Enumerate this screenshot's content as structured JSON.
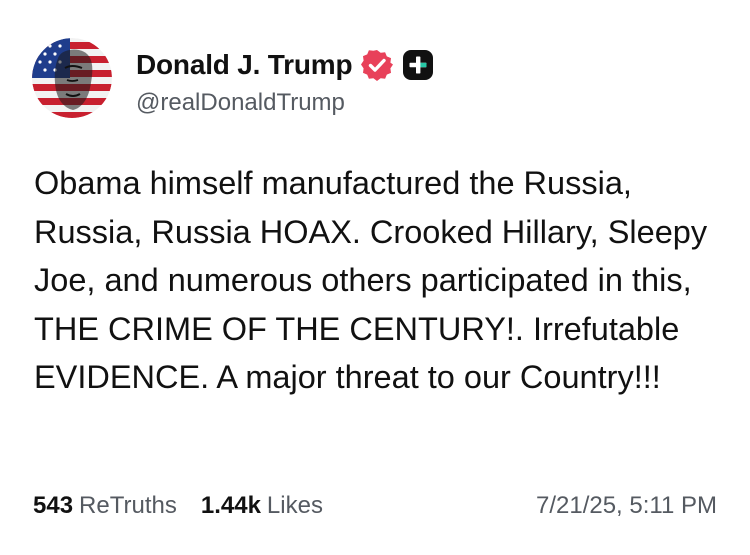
{
  "author": {
    "display_name": "Donald J. Trump",
    "handle": "@realDonaldTrump",
    "avatar_icon": "flag-portrait-avatar",
    "verified_icon": "verified-badge-icon",
    "verified_color": "#e8415a",
    "plus_icon": "truth-plus-icon"
  },
  "post": {
    "text": "Obama himself manufactured the Russia, Russia, Russia HOAX. Crooked Hillary, Sleepy Joe, and numerous others participated in this, THE CRIME OF THE CENTURY!. Irrefutable EVIDENCE. A major threat to our Country!!!"
  },
  "stats": {
    "retruths_count": "543",
    "retruths_label": "ReTruths",
    "likes_count": "1.44k",
    "likes_label": "Likes"
  },
  "timestamp": "7/21/25, 5:11 PM",
  "colors": {
    "text": "#111111",
    "muted": "#555a61",
    "accent": "#e8415a",
    "background": "#ffffff"
  }
}
